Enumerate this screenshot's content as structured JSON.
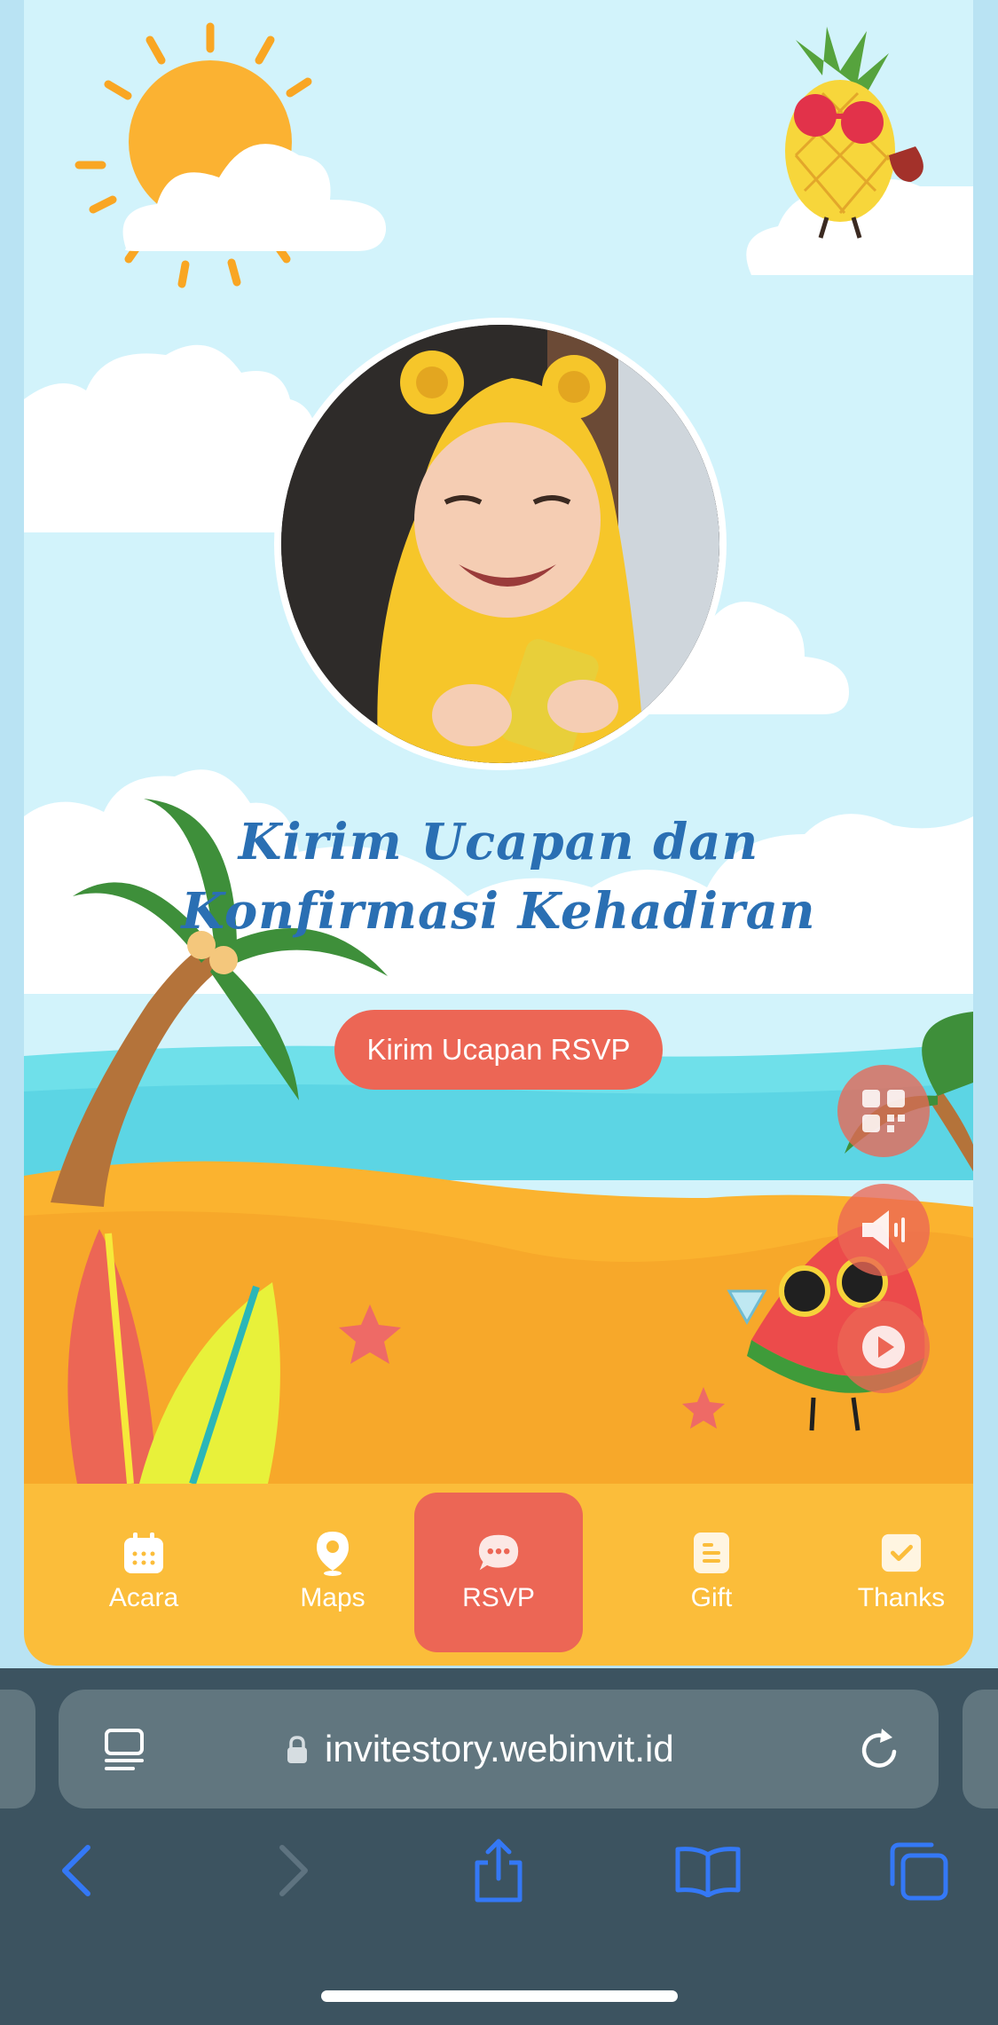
{
  "invite": {
    "title_line1": "Kirim Ucapan dan",
    "title_line2": "Konfirmasi Kehadiran",
    "rsvp_button_label": "Kirim Ucapan RSVP"
  },
  "floating_buttons": [
    "qr-code-icon",
    "speaker-icon",
    "play-icon"
  ],
  "tabbar": {
    "items": [
      {
        "label": "Acara",
        "icon": "calendar-icon"
      },
      {
        "label": "Maps",
        "icon": "map-pin-icon"
      },
      {
        "label": "RSVP",
        "icon": "chat-bubble-icon",
        "active": true
      },
      {
        "label": "Gift",
        "icon": "document-icon"
      },
      {
        "label": "Thanks",
        "icon": "checkbox-icon"
      }
    ]
  },
  "browser": {
    "url": "invitestory.webinvit.id",
    "icons": [
      "reader-icon",
      "lock-icon",
      "reload-icon",
      "back-icon",
      "forward-icon",
      "share-icon",
      "bookmarks-icon",
      "tabs-icon"
    ]
  },
  "colors": {
    "sky": "#d2f3fb",
    "sand": "#fbbd3a",
    "accent": "#ec6655",
    "title": "#2a6fb3",
    "browser_bg": "#3c5360",
    "ios_blue": "#3478f6"
  }
}
